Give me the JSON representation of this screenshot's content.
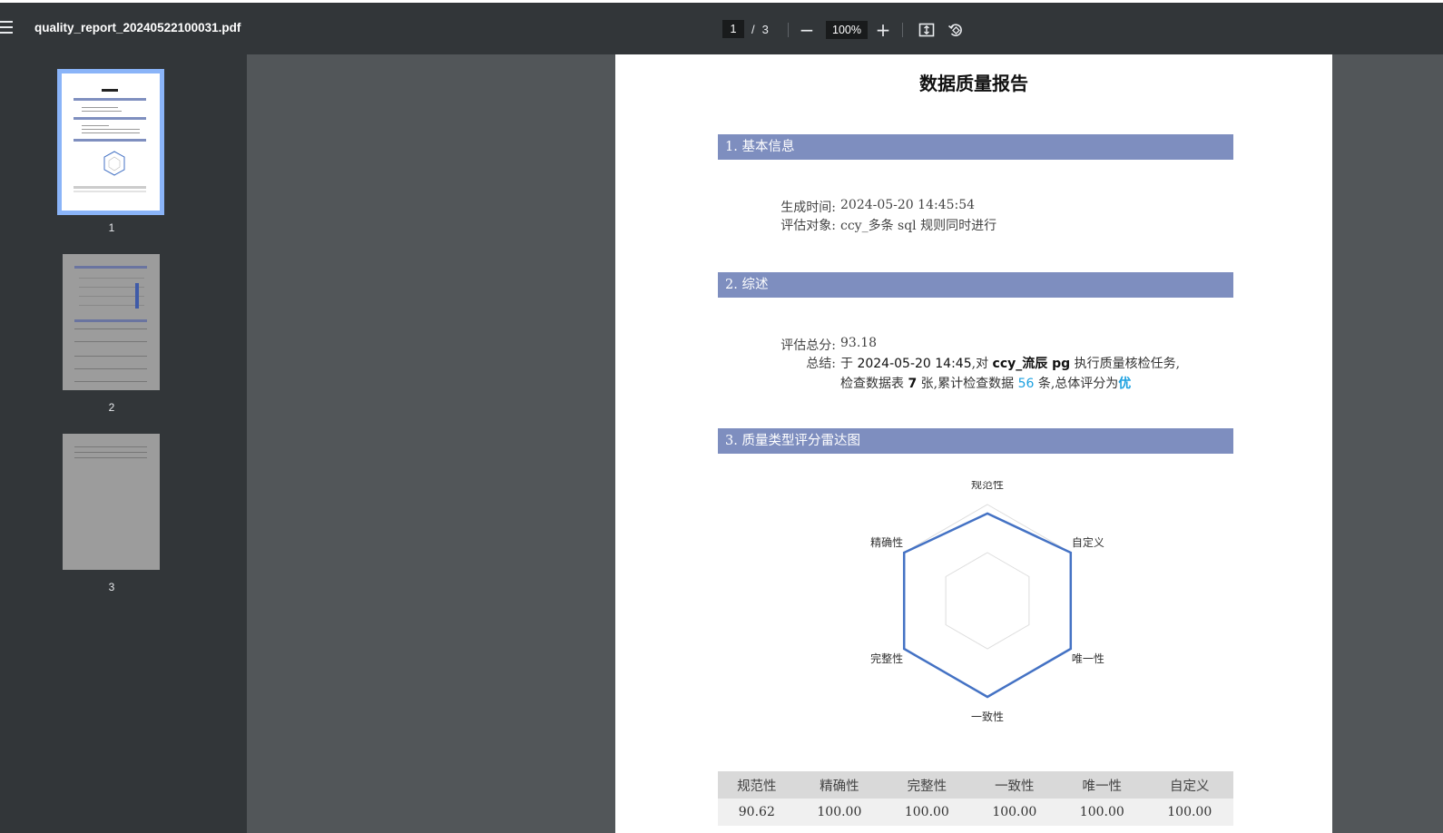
{
  "toolbar": {
    "file_name": "quality_report_20240522100031.pdf",
    "current_page": "1",
    "page_sep": "/",
    "total_pages": "3",
    "zoom": "100%",
    "zoom_out_glyph": "−",
    "zoom_in_glyph": "+",
    "icons": [
      "menu-icon",
      "zoom-out-icon",
      "zoom-in-icon",
      "fit-page-icon",
      "rotate-icon"
    ]
  },
  "sidebar": {
    "thumbnails": [
      {
        "label": "1",
        "selected": true
      },
      {
        "label": "2",
        "selected": false
      },
      {
        "label": "3",
        "selected": false
      }
    ]
  },
  "document": {
    "title": "数据质量报告",
    "sections": {
      "basic": {
        "heading": "1. 基本信息",
        "gen_time_label": "生成时间:",
        "gen_time_value": "2024-05-20 14:45:54",
        "target_label": "评估对象:",
        "target_value": "ccy_多条 sql 规则同时进行"
      },
      "summary": {
        "heading": "2. 综述",
        "score_label": "评估总分:",
        "score_value": "93.18",
        "conclusion_label": "总结:",
        "line1_pre": "于 ",
        "line1_time": "2024-05-20 14:45",
        "line1_mid": ",对 ",
        "line1_target": "ccy_流辰 pg",
        "line1_post": " 执行质量核检任务,",
        "line2_pre": "检查数据表 ",
        "line2_tables": "7",
        "line2_mid": " 张,累计检查数据 ",
        "line2_rows": "56",
        "line2_post": " 条,总体评分为",
        "line2_grade": "优"
      },
      "radar": {
        "heading": "3. 质量类型评分雷达图"
      }
    }
  },
  "chart_data": {
    "type": "radar",
    "axes": [
      "规范性",
      "自定义",
      "唯一性",
      "一致性",
      "完整性",
      "精确性"
    ],
    "values": [
      90.62,
      100.0,
      100.0,
      100.0,
      100.0,
      100.0
    ],
    "range": [
      0,
      100
    ],
    "series_color": "#4472c4"
  },
  "table": {
    "headers": [
      "规范性",
      "精确性",
      "完整性",
      "一致性",
      "唯一性",
      "自定义"
    ],
    "values": [
      "90.62",
      "100.00",
      "100.00",
      "100.00",
      "100.00",
      "100.00"
    ]
  },
  "colors": {
    "section_bar": "#7e8ebf",
    "highlight": "#1aa0e0",
    "toolbar_bg": "#323639",
    "viewer_bg": "#525659"
  }
}
